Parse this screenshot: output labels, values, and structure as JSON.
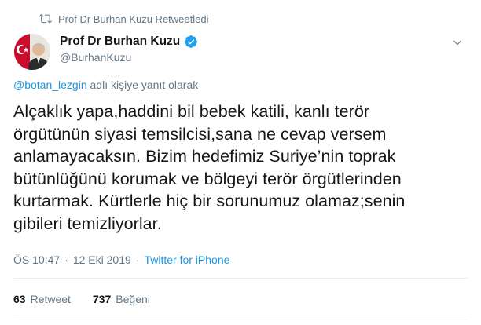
{
  "retweet": {
    "text": "Prof Dr Burhan Kuzu Retweetledi",
    "icon": "retweet-icon"
  },
  "author": {
    "name": "Prof Dr Burhan Kuzu",
    "handle": "@BurhanKuzu",
    "verified_icon": "verified-badge-icon"
  },
  "reply": {
    "mention": "@botan_lezgin",
    "suffix": "adlı kişiye yanıt olarak"
  },
  "tweet": {
    "lines": [
      "Alçaklık yapa,haddini bil bebek katili, kanlı terör",
      "örgütünün siyasi temsilcisi,sana ne cevap versem",
      "anlamayacaksın. Bizim hedefimiz Suriye’nin toprak",
      "bütünlüğünü korumak ve bölgeyi terör örgütlerinden",
      "kurtarmak. Kürtlerle hiç bir sorunumuz olamaz;senin",
      "gibileri temizliyorlar."
    ]
  },
  "meta": {
    "time": "ÖS 10:47",
    "sep1": "·",
    "date": "12 Eki 2019",
    "sep2": "·",
    "source": "Twitter for iPhone"
  },
  "stats": {
    "retweets_count": "63",
    "retweets_label": "Retweet",
    "likes_count": "737",
    "likes_label": "Beğeni"
  },
  "colors": {
    "link": "#1b95e0",
    "muted": "#657786",
    "text": "#14171a",
    "verified": "#1da1f2"
  }
}
